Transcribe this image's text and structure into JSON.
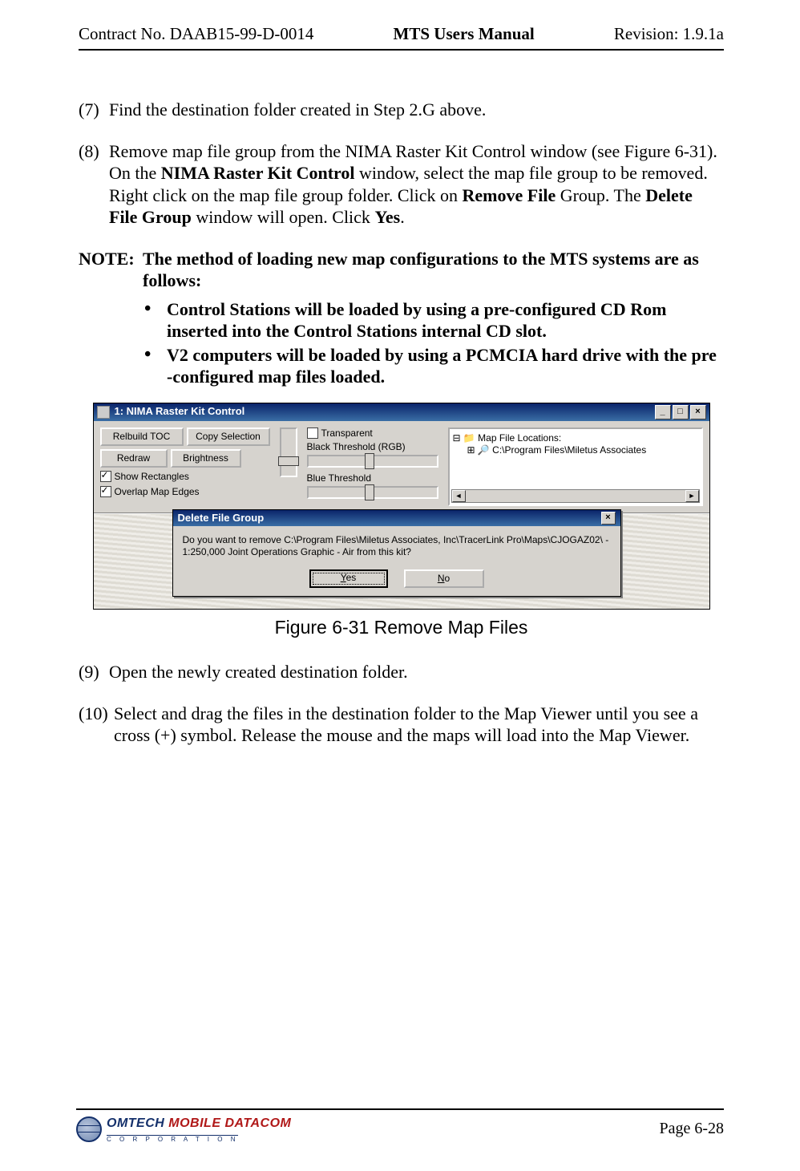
{
  "hdr": {
    "left": "Contract No. DAAB15-99-D-0014",
    "center": "MTS Users Manual",
    "right": "Revision:  1.9.1a"
  },
  "items": {
    "n7": "(7)",
    "t7": "Find the destination folder created in Step 2.G above.",
    "n8": "(8)",
    "t8a": "Remove map file group from the NIMA Raster Kit Control window (see Figure 6-31). On the ",
    "t8b": "NIMA Raster Kit Control",
    "t8c": " window, select the map file group to be removed. Right click on the map file group folder. Click on ",
    "t8d": "Remove File",
    "t8e": " Group. The ",
    "t8f": "Delete File Group",
    "t8g": " window will open. Click ",
    "t8h": "Yes",
    "t8i": ".",
    "noteLabel": "NOTE:",
    "noteBody": "The method of loading new map configurations to the MTS systems are as follows:",
    "b1": "Control Stations will be loaded by using a pre-configured CD Rom inserted into the Control Stations internal CD slot.",
    "b2": "V2 computers will be loaded by using a PCMCIA hard drive with the pre -configured map files loaded.",
    "n9": "(9)",
    "t9": "Open the newly created destination folder.",
    "n10": "(10)",
    "t10": "Select and drag the files in the destination folder to the Map Viewer until you see a cross (+) symbol.  Release the mouse and the maps will load into the Map Viewer."
  },
  "fig": {
    "caption": "Figure 6-31   Remove Map Files",
    "title": "1: NIMA Raster Kit Control",
    "btnRebuild": "Relbuild TOC",
    "btnCopy": "Copy Selection",
    "btnRedraw": "Redraw",
    "btnBright": "Brightness",
    "chkRect": "Show Rectangles",
    "chkOverlap": "Overlap Map Edges",
    "chkTrans": "Transparent",
    "lblBlack": "Black Threshold (RGB)",
    "lblBlue": "Blue Threshold",
    "treeRoot": "Map File Locations:",
    "treeChild": "C:\\Program Files\\Miletus Associates",
    "dTitle": "Delete File Group",
    "dBody": "Do you want to remove C:\\Program Files\\Miletus Associates, Inc\\TracerLink Pro\\Maps\\CJOGAZ02\\ - 1:250,000 Joint Operations Graphic - Air from this kit?",
    "dYesU": "Y",
    "dYes": "es",
    "dNoU": "N",
    "dNo": "o",
    "minBtn": "_",
    "maxBtn": "□",
    "closeBtn": "×",
    "scrL": "◄",
    "scrR": "►"
  },
  "ftr": {
    "brand1a": "OMTECH",
    "brand1b": "MOBILE DATACOM",
    "brand2": "C  O  R  P  O  R  A  T  I  O  N",
    "page": "Page 6-28"
  }
}
